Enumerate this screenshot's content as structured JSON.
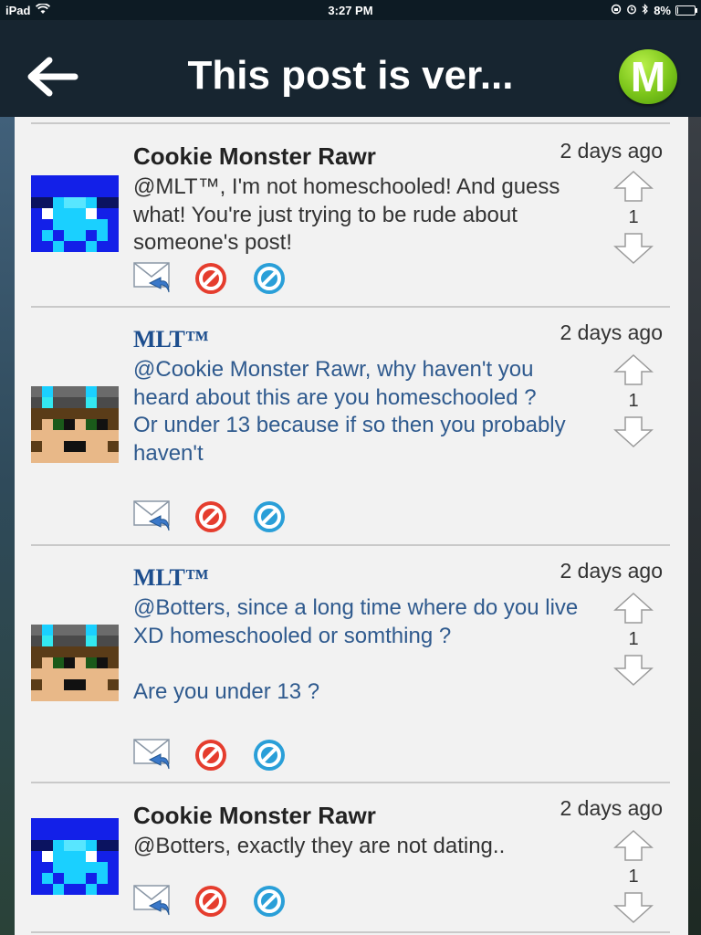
{
  "status_bar": {
    "device": "iPad",
    "time": "3:27 PM",
    "battery": "8%",
    "battery_level": 0.08
  },
  "header": {
    "title": "This post is ver...",
    "logo_letter": "M",
    "accent": "#7bc51a"
  },
  "posts": [
    {
      "author": "Cookie Monster Rawr",
      "time": "2 days ago",
      "text": "@MLT™, I'm not homeschooled! And guess what! You're just trying to be rude about someone's post!",
      "votes": "1"
    },
    {
      "author": "MLT™",
      "time": "2 days ago",
      "text": "@Cookie Monster Rawr, why haven't you heard about this are you homeschooled ?\nOr under 13 because if so then you probably haven't",
      "votes": "1"
    },
    {
      "author": "MLT™",
      "time": "2 days ago",
      "text": "@Botters, since a long time where do you live XD homeschooled or somthing ?\n\nAre you under 13 ?",
      "votes": "1"
    },
    {
      "author": "Cookie Monster Rawr",
      "time": "2 days ago",
      "text": "@Botters, exactly they are not dating..",
      "votes": "1"
    }
  ],
  "icons": {
    "reply": "reply-envelope-icon",
    "report": "red-block-icon",
    "block": "blue-block-icon",
    "upvote": "up-arrow-icon",
    "downvote": "down-arrow-icon"
  }
}
